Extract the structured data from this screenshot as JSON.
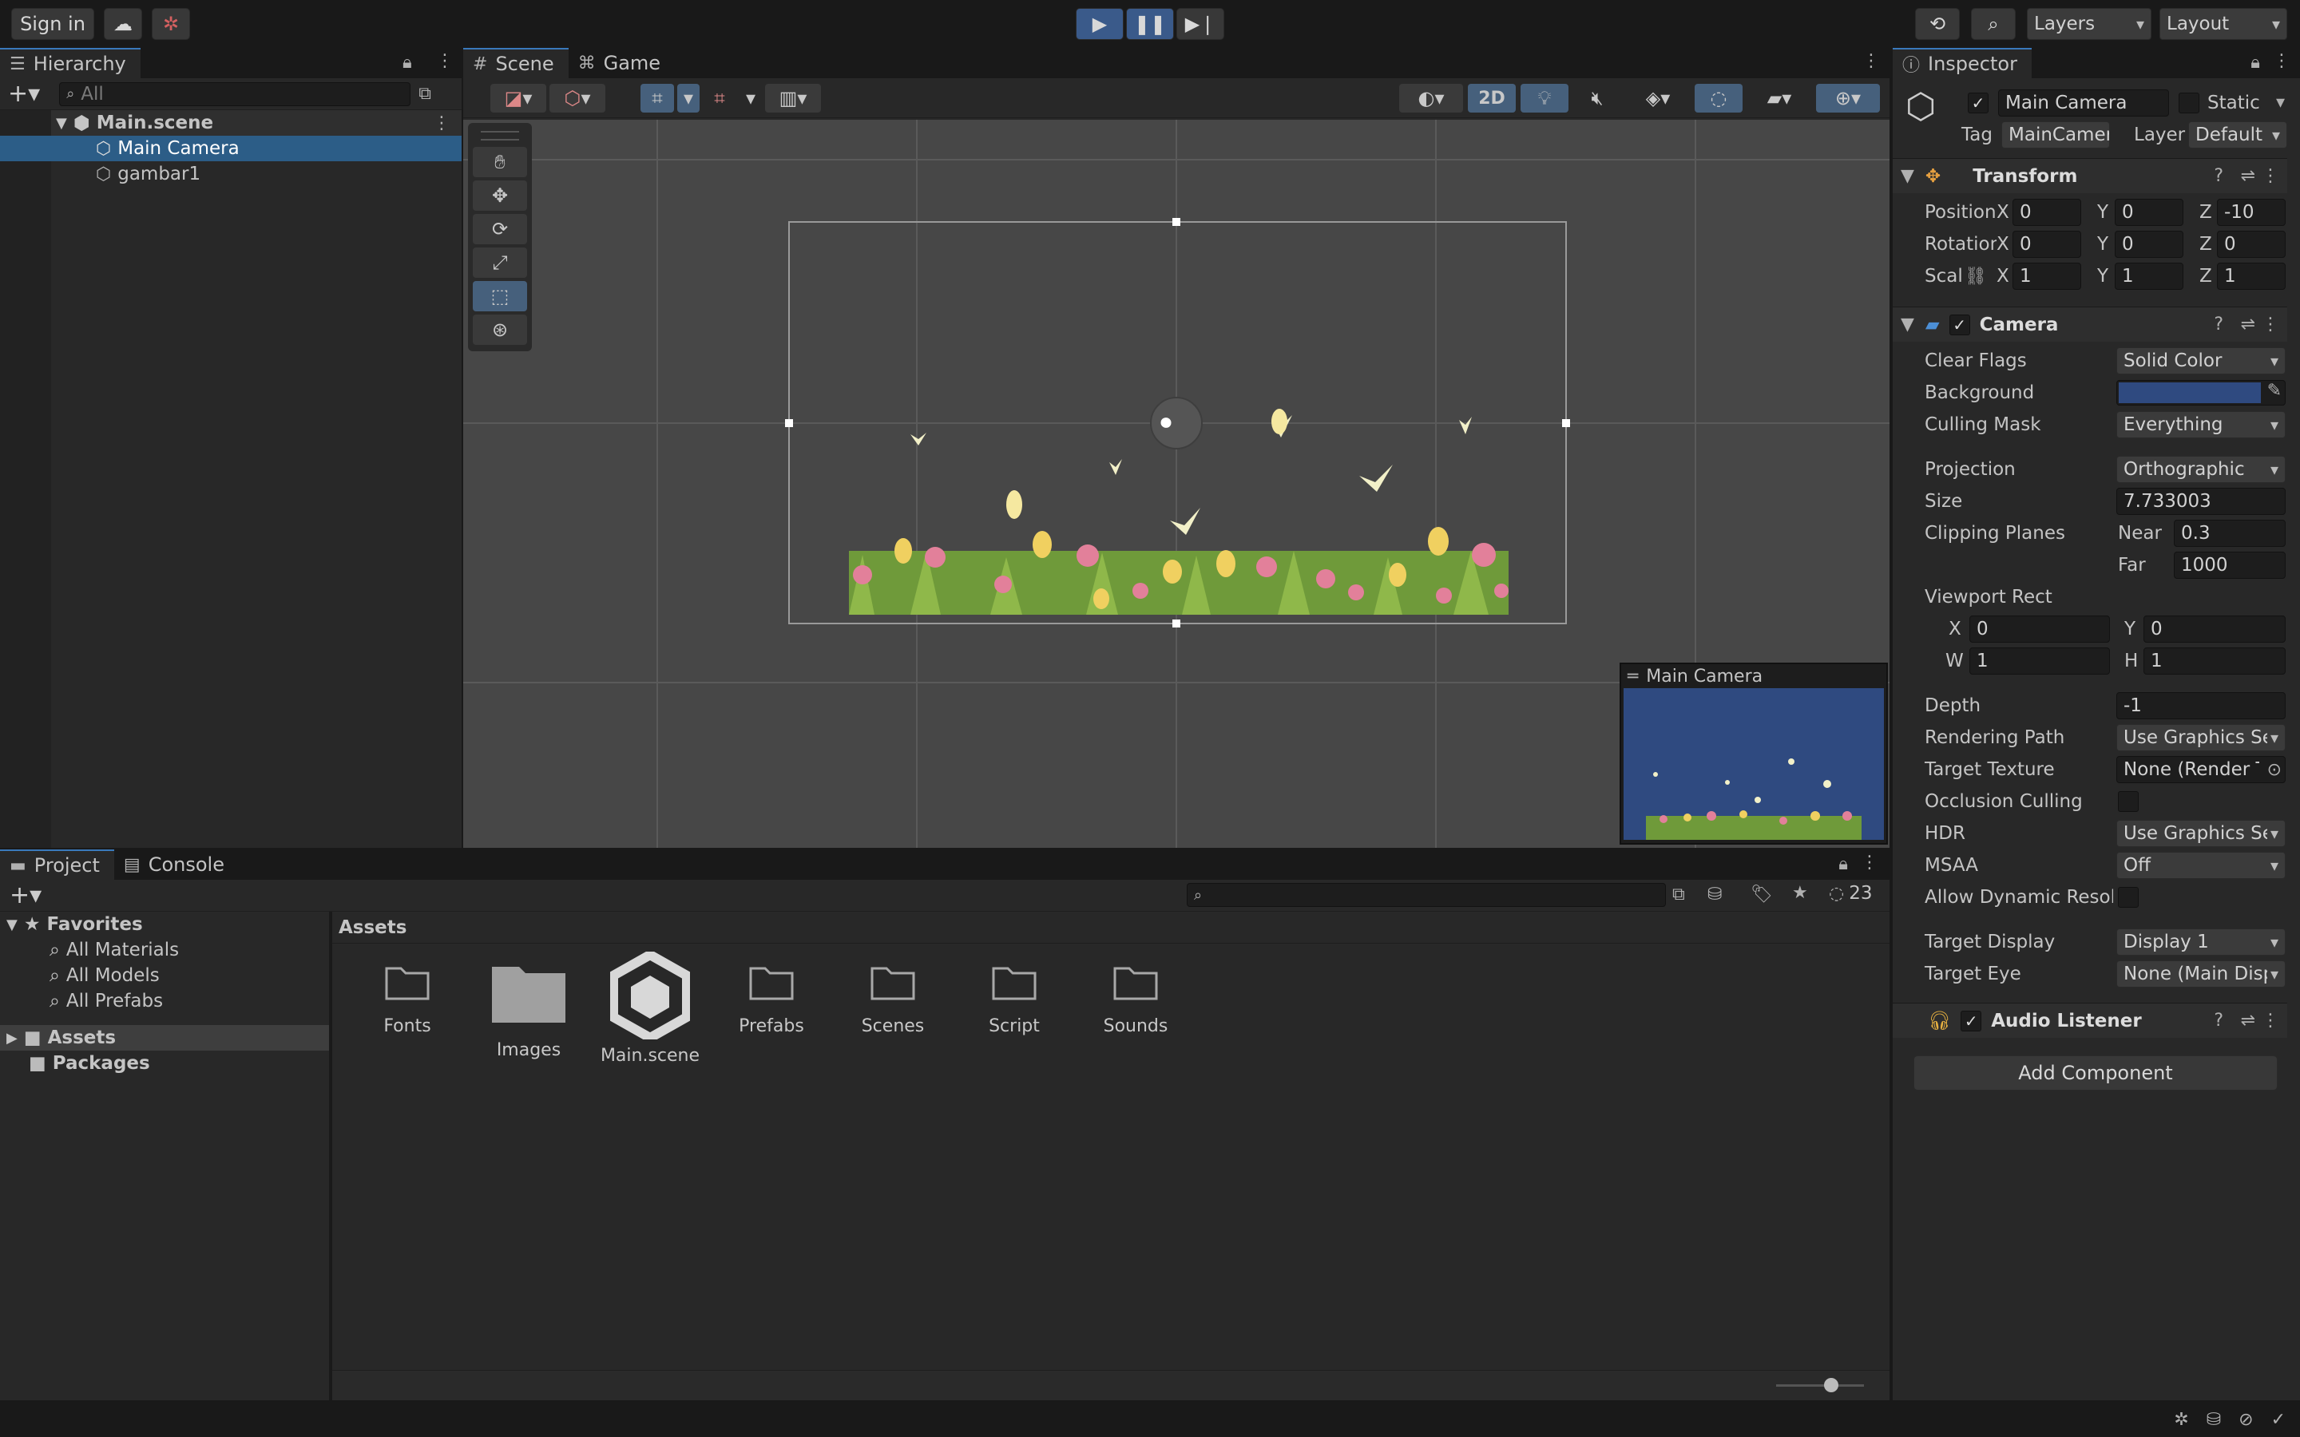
{
  "toolbar": {
    "sign_in": "Sign in",
    "layers": "Layers",
    "layout": "Layout"
  },
  "hierarchy": {
    "tab": "Hierarchy",
    "search_placeholder": "All",
    "scene": "Main.scene",
    "items": [
      "Main Camera",
      "gambar1"
    ]
  },
  "scene_view": {
    "tabs": [
      "Scene",
      "Game"
    ],
    "mode_2d": "2D",
    "camera_preview_title": "Main Camera"
  },
  "project": {
    "tabs": [
      "Project",
      "Console"
    ],
    "hidden_count": "23",
    "favorites_label": "Favorites",
    "favorites": [
      "All Materials",
      "All Models",
      "All Prefabs"
    ],
    "roots": [
      "Assets",
      "Packages"
    ],
    "breadcrumb": "Assets",
    "assets": [
      "Fonts",
      "Images",
      "Main.scene",
      "Prefabs",
      "Scenes",
      "Script",
      "Sounds"
    ]
  },
  "inspector": {
    "tab": "Inspector",
    "object_name": "Main Camera",
    "static_label": "Static",
    "tag_label": "Tag",
    "tag_value": "MainCamera",
    "layer_label": "Layer",
    "layer_value": "Default",
    "transform": {
      "title": "Transform",
      "position_label": "Position",
      "rotation_label": "Rotation",
      "scale_label": "Scale",
      "position": {
        "x": "0",
        "y": "0",
        "z": "-10"
      },
      "rotation": {
        "x": "0",
        "y": "0",
        "z": "0"
      },
      "scale": {
        "x": "1",
        "y": "1",
        "z": "1"
      }
    },
    "camera": {
      "title": "Camera",
      "clear_flags_label": "Clear Flags",
      "clear_flags": "Solid Color",
      "background_label": "Background",
      "background_color": "#2f4a80",
      "culling_mask_label": "Culling Mask",
      "culling_mask": "Everything",
      "projection_label": "Projection",
      "projection": "Orthographic",
      "size_label": "Size",
      "size": "7.733003",
      "clipping_label": "Clipping Planes",
      "near_label": "Near",
      "near": "0.3",
      "far_label": "Far",
      "far": "1000",
      "viewport_label": "Viewport Rect",
      "vx": "0",
      "vy": "0",
      "vw": "1",
      "vh": "1",
      "depth_label": "Depth",
      "depth": "-1",
      "rendering_path_label": "Rendering Path",
      "rendering_path": "Use Graphics Settings",
      "target_texture_label": "Target Texture",
      "target_texture": "None (Render Texture)",
      "occlusion_label": "Occlusion Culling",
      "hdr_label": "HDR",
      "hdr": "Use Graphics Settings",
      "msaa_label": "MSAA",
      "msaa": "Off",
      "dynamic_res_label": "Allow Dynamic Resolution",
      "target_display_label": "Target Display",
      "target_display": "Display 1",
      "target_eye_label": "Target Eye",
      "target_eye": "None (Main Display)"
    },
    "audio_listener": "Audio Listener",
    "add_component": "Add Component"
  },
  "colors": {
    "accent": "#3a79bb",
    "selection": "#2c5d87",
    "scene_bg": "#474747",
    "camera_bg": "#2f4a80"
  }
}
